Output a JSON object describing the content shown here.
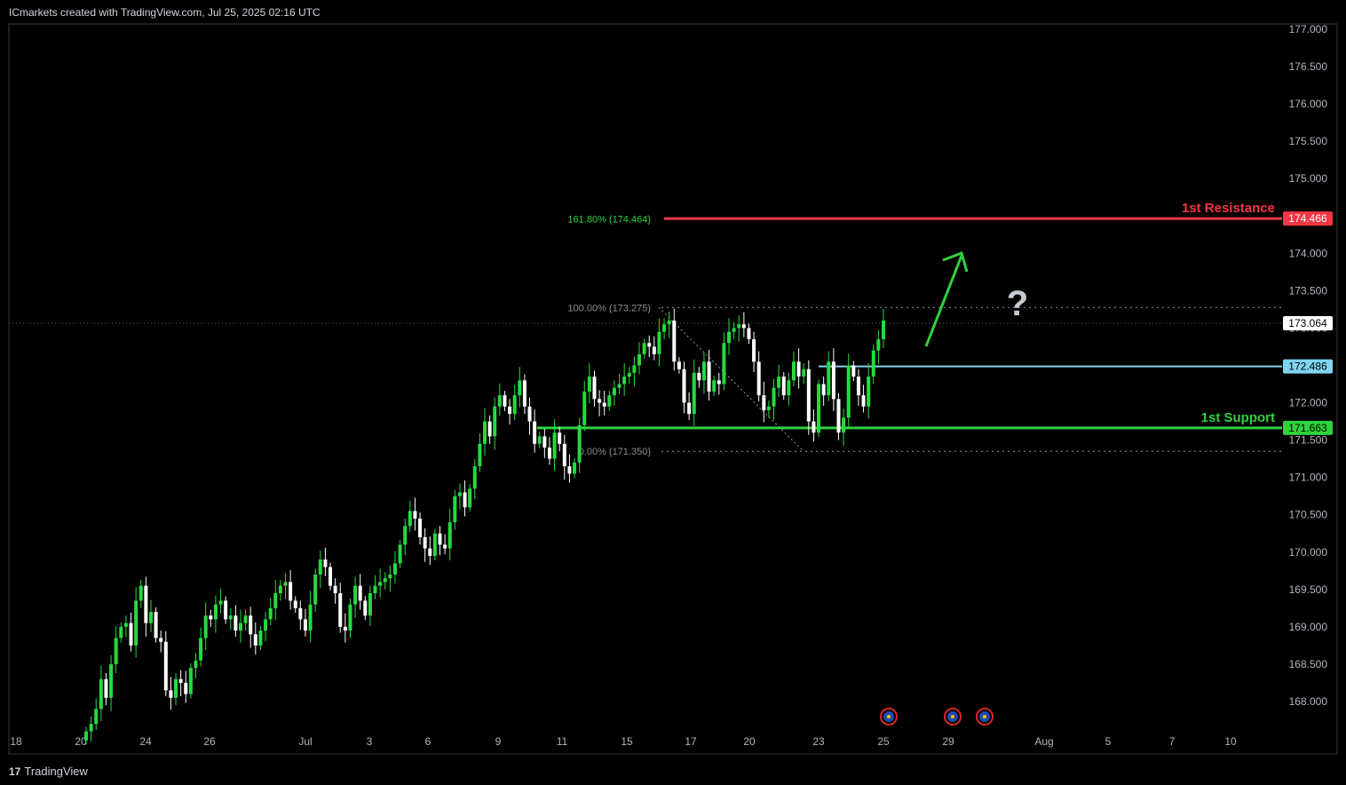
{
  "header": {
    "text": "ICmarkets created with TradingView.com, Jul 25, 2025 02:16 UTC"
  },
  "footer": {
    "brand": "TradingView",
    "logo": "tradingview-logo-icon"
  },
  "colors": {
    "background": "#000000",
    "up": "#27d93f",
    "down": "#ffffff",
    "resistance": "#f23645",
    "support": "#2fd33d",
    "pivot": "#7fd4f0",
    "fib_text": "#8b8b8b",
    "fib_green": "#2fd33d",
    "arrow": "#2fd33d",
    "question": "#c8ccd3",
    "event": "#d9262e"
  },
  "chart_data": {
    "type": "candlestick",
    "ylim": [
      167.7,
      177.1
    ],
    "y_ticks": [
      "177.000",
      "176.500",
      "176.000",
      "175.500",
      "175.000",
      "174.500",
      "174.000",
      "173.500",
      "173.000",
      "172.500",
      "172.000",
      "171.500",
      "171.000",
      "170.500",
      "170.000",
      "169.500",
      "169.000",
      "168.500",
      "168.000"
    ],
    "x_ticks": [
      "18",
      "20",
      "24",
      "26",
      "Jul",
      "3",
      "6",
      "9",
      "11",
      "15",
      "17",
      "20",
      "23",
      "25",
      "29",
      "Aug",
      "5",
      "7",
      "10"
    ],
    "levels": [
      {
        "name": "1st Resistance",
        "value": 174.466,
        "label": "174.466",
        "role": "resistance"
      },
      {
        "name": "",
        "value": 172.486,
        "label": "172.486",
        "role": "pivot"
      },
      {
        "name": "1st Support",
        "value": 171.663,
        "label": "171.663",
        "role": "support"
      }
    ],
    "current_price": {
      "value": 173.064,
      "label": "173.064"
    },
    "fib_levels": [
      {
        "label": "161.80% (174.464)",
        "value": 174.464,
        "style": "extension"
      },
      {
        "label": "100.00% (173.275)",
        "value": 173.275,
        "style": "dotted"
      },
      {
        "label": "0.00% (171.350)",
        "value": 171.35,
        "style": "dotted"
      }
    ],
    "annotations": {
      "arrow": "up-arrow",
      "question": "?",
      "events": [
        "event-icon",
        "event-icon",
        "event-icon"
      ]
    },
    "candles_close": [
      167.6,
      167.7,
      167.9,
      168.3,
      168.05,
      168.5,
      168.85,
      169.0,
      169.05,
      168.75,
      169.35,
      169.55,
      169.05,
      169.2,
      168.85,
      168.8,
      168.15,
      168.05,
      168.3,
      168.25,
      168.1,
      168.45,
      168.55,
      168.85,
      169.15,
      169.1,
      169.3,
      169.35,
      169.1,
      169.15,
      168.95,
      169.05,
      169.15,
      168.9,
      168.75,
      168.95,
      169.1,
      169.25,
      169.45,
      169.55,
      169.6,
      169.35,
      169.25,
      169.1,
      168.95,
      169.3,
      169.7,
      169.9,
      169.8,
      169.55,
      169.45,
      169.0,
      168.95,
      169.3,
      169.55,
      169.35,
      169.15,
      169.45,
      169.55,
      169.6,
      169.65,
      169.7,
      169.85,
      170.1,
      170.35,
      170.55,
      170.45,
      170.2,
      170.05,
      169.95,
      170.25,
      170.1,
      170.05,
      170.4,
      170.75,
      170.8,
      170.6,
      170.85,
      171.15,
      171.45,
      171.75,
      171.55,
      171.95,
      172.1,
      171.95,
      171.85,
      172.1,
      172.3,
      171.95,
      171.75,
      171.45,
      171.55,
      171.4,
      171.25,
      171.6,
      171.45,
      171.15,
      171.05,
      171.2,
      171.7,
      172.15,
      172.35,
      172.05,
      172.0,
      171.95,
      172.1,
      172.2,
      172.25,
      172.35,
      172.4,
      172.5,
      172.65,
      172.8,
      172.75,
      172.65,
      172.95,
      173.05,
      173.1,
      172.55,
      172.45,
      172.0,
      171.85,
      172.4,
      172.3,
      172.55,
      172.15,
      172.3,
      172.25,
      172.8,
      172.95,
      173.0,
      173.05,
      173.0,
      172.85,
      172.55,
      172.1,
      171.9,
      171.95,
      172.2,
      172.35,
      172.1,
      172.3,
      172.55,
      172.35,
      172.45,
      171.75,
      171.6,
      172.25,
      172.1,
      172.55,
      172.05,
      171.6,
      171.8,
      172.5,
      172.35,
      172.1,
      171.95,
      172.35,
      172.7,
      172.85,
      173.1
    ]
  }
}
